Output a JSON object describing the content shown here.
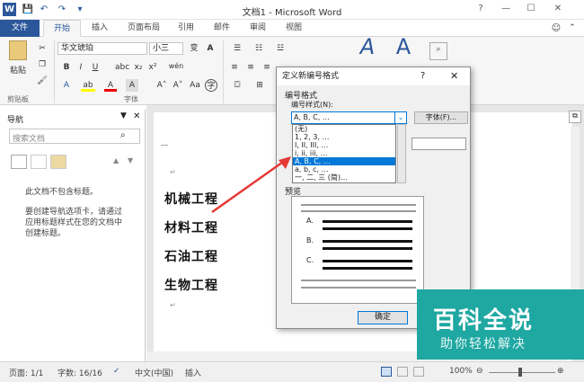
{
  "app": {
    "title": "文档1 - Microsoft Word",
    "logo": "W",
    "min": "—",
    "max": "☐",
    "close": "✕",
    "help": "?"
  },
  "tabs": {
    "file": "文件",
    "home": "开始",
    "insert": "插入",
    "layout": "页面布局",
    "ref": "引用",
    "mail": "邮件",
    "review": "审阅",
    "view": "视图"
  },
  "ribbon": {
    "paste": "粘贴",
    "clipboard": "剪贴板",
    "font_group": "字体",
    "font_name": "华文琥珀",
    "font_size": "小三",
    "wen": "wén",
    "style_a": "A"
  },
  "nav": {
    "title": "导航",
    "search_placeholder": "搜索文档",
    "no_headings": "此文档不包含标题。",
    "help": "要创建导航选项卡，请通过应用标题样式在您的文档中创建标题。"
  },
  "doc": {
    "lines": [
      "机械工程",
      "材料工程",
      "石油工程",
      "生物工程"
    ]
  },
  "dialog": {
    "title": "定义新编号格式",
    "help": "?",
    "close": "✕",
    "section": "编号格式",
    "style_label": "编号样式(N):",
    "style_value": "A, B, C, …",
    "font_btn": "字体(F)...",
    "list": [
      "(无)",
      "1, 2, 3, …",
      "I, II, III, …",
      "i, ii, iii, …",
      "A, B, C, …",
      "a, b, c, …",
      "一, 二, 三 (简)…"
    ],
    "selected_index": 4,
    "preview_label": "预览",
    "preview_items": [
      "A.",
      "B.",
      "C."
    ],
    "ok": "确定"
  },
  "status": {
    "page": "页面: 1/1",
    "words": "字数: 16/16",
    "lang": "中文(中国)",
    "mode": "插入",
    "zoom": "100%"
  },
  "watermark": {
    "title": "百科全说",
    "sub": "助你轻松解决"
  },
  "colors": {
    "accent": "#2b579a",
    "arrow": "#e53935",
    "watermark": "#1fa7a2"
  }
}
